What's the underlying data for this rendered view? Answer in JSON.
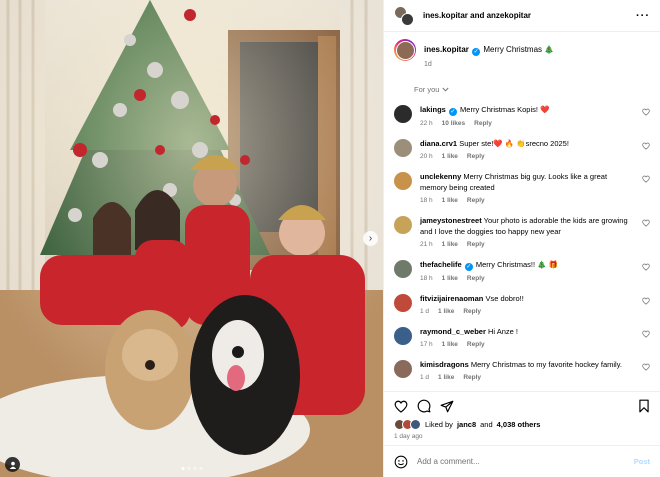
{
  "header": {
    "names": "ines.kopitar and anzekopitar"
  },
  "caption": {
    "user": "ines.kopitar",
    "text": "Merry Christmas 🎄",
    "time": "1d"
  },
  "sort": {
    "label": "For you"
  },
  "comments": [
    {
      "user": "lakings",
      "verified": true,
      "text": "Merry Christmas Kopis! ❤️",
      "time": "22 h",
      "likes": "10 likes",
      "reply": "Reply",
      "avatar": "#2b2b2b"
    },
    {
      "user": "diana.crv1",
      "verified": false,
      "text": "Super ste!❤️ 🔥 👏srecno 2025!",
      "time": "20 h",
      "likes": "1 like",
      "reply": "Reply",
      "avatar": "#9c8f7a"
    },
    {
      "user": "unclekenny",
      "verified": false,
      "text": "Merry Christmas big guy. Looks like a great memory being created",
      "time": "18 h",
      "likes": "1 like",
      "reply": "Reply",
      "avatar": "#c9924a"
    },
    {
      "user": "jameystonestreet",
      "verified": false,
      "text": "Your photo is adorable the kids are growing and I love the doggies too happy new year",
      "time": "21 h",
      "likes": "1 like",
      "reply": "Reply",
      "avatar": "#c7a35a"
    },
    {
      "user": "thefachelife",
      "verified": true,
      "text": "Merry Christmas!! 🎄 🎁",
      "time": "18 h",
      "likes": "1 like",
      "reply": "Reply",
      "avatar": "#6f7a6a"
    },
    {
      "user": "fitvizijairenaoman",
      "verified": false,
      "text": "Vse dobro!!",
      "time": "1 d",
      "likes": "1 like",
      "reply": "Reply",
      "avatar": "#c04a3a"
    },
    {
      "user": "raymond_c_weber",
      "verified": false,
      "text": "Hi Anze !",
      "time": "17 h",
      "likes": "1 like",
      "reply": "Reply",
      "avatar": "#3a5f8a"
    },
    {
      "user": "kimisdragons",
      "verified": false,
      "text": "Merry Christmas to my favorite hockey family.",
      "time": "1 d",
      "likes": "1 like",
      "reply": "Reply",
      "avatar": "#8a6a5a"
    }
  ],
  "likes": {
    "prefix": "Liked by",
    "user": "janc8",
    "and": "and",
    "others": "4,038 others"
  },
  "posted": "1 day ago",
  "add_comment": {
    "placeholder": "Add a comment...",
    "post": "Post"
  },
  "icons": [
    "more-icon",
    "heart-icon",
    "comment-icon",
    "share-icon",
    "bookmark-icon",
    "emoji-icon",
    "next-icon",
    "tag-user-icon",
    "chevron-down-icon"
  ]
}
